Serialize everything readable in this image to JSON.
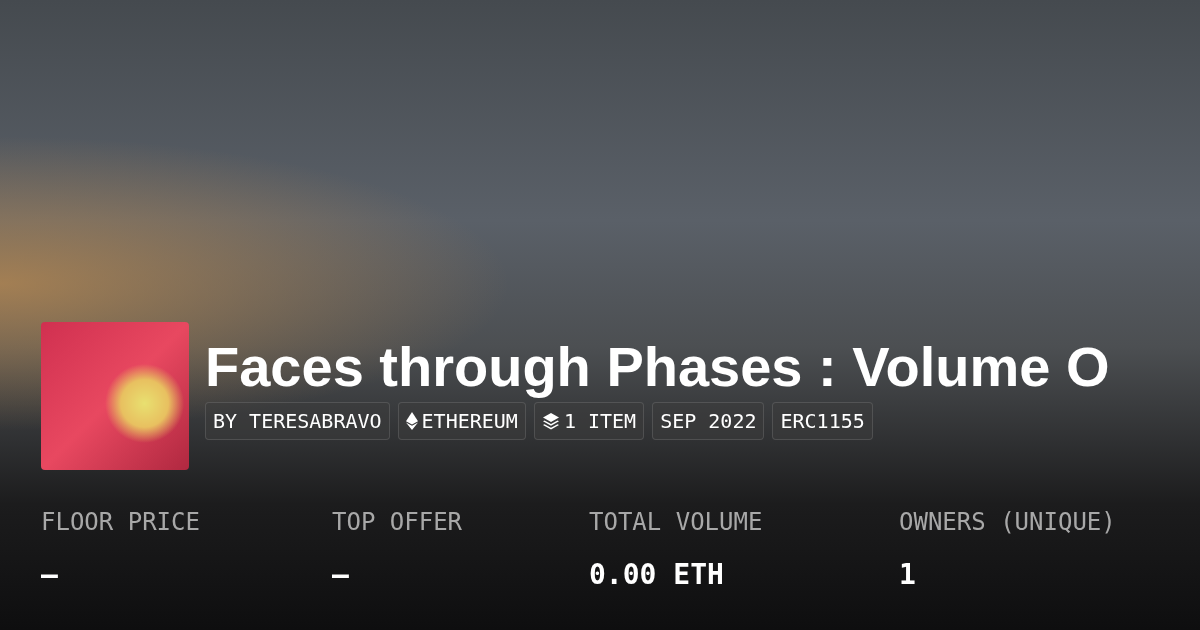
{
  "collection": {
    "title": "Faces through Phases : Volume O",
    "tags": [
      {
        "kind": "text",
        "label": "BY TERESABRAVO"
      },
      {
        "kind": "ethereum",
        "label": "ETHEREUM"
      },
      {
        "kind": "items",
        "label": "1 ITEM"
      },
      {
        "kind": "text",
        "label": "SEP 2022"
      },
      {
        "kind": "text",
        "label": "ERC1155"
      }
    ]
  },
  "stats": [
    {
      "label": "FLOOR PRICE",
      "value": "–"
    },
    {
      "label": "TOP OFFER",
      "value": "–"
    },
    {
      "label": "TOTAL VOLUME",
      "value": "0.00 ETH"
    },
    {
      "label": "OWNERS (UNIQUE)",
      "value": "1"
    }
  ]
}
